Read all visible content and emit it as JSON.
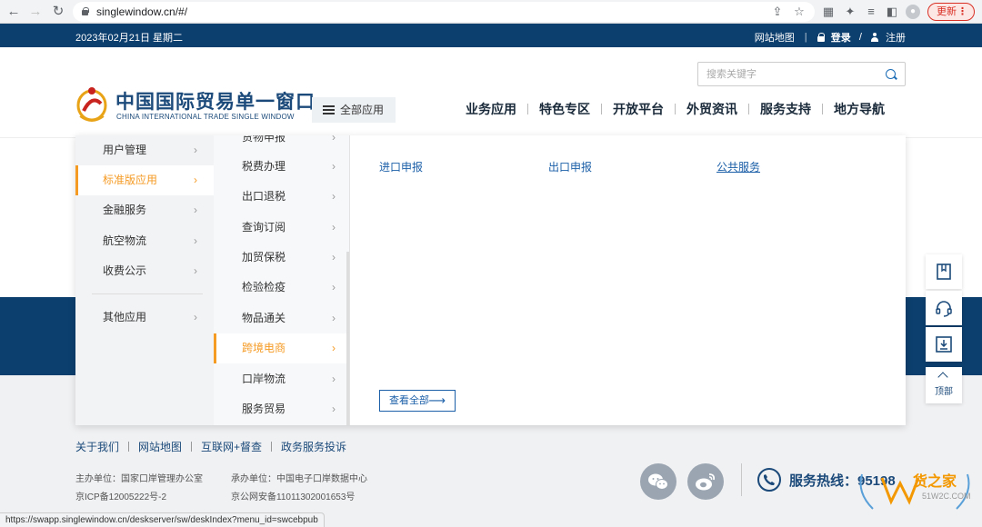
{
  "browser": {
    "url": "singlewindow.cn/#/",
    "update_label": "更新",
    "status_url": "https://swapp.singlewindow.cn/deskserver/sw/deskIndex?menu_id=swcebpub"
  },
  "topbar": {
    "date": "2023年02月21日 星期二",
    "sitemap": "网站地图",
    "login": "登录",
    "slash": "/",
    "register": "注册"
  },
  "header": {
    "logo_cn": "中国国际贸易单一窗口",
    "logo_en": "CHINA INTERNATIONAL TRADE SINGLE WINDOW",
    "all_apps": "全部应用",
    "search_placeholder": "搜索关键字",
    "nav": [
      "业务应用",
      "特色专区",
      "开放平台",
      "外贸资讯",
      "服务支持",
      "地方导航"
    ]
  },
  "menu": {
    "col1": [
      {
        "label": "用户管理",
        "arrow": "›"
      },
      {
        "label": "标准版应用",
        "arrow": "›"
      },
      {
        "label": "金融服务",
        "arrow": "›"
      },
      {
        "label": "航空物流",
        "arrow": "›"
      },
      {
        "label": "收费公示",
        "arrow": "›"
      },
      {
        "label": "其他应用",
        "arrow": "›"
      }
    ],
    "col2": [
      {
        "label": "货物申报",
        "arrow": "›"
      },
      {
        "label": "税费办理",
        "arrow": "›"
      },
      {
        "label": "出口退税",
        "arrow": "›"
      },
      {
        "label": "查询订阅",
        "arrow": "›"
      },
      {
        "label": "加贸保税",
        "arrow": "›"
      },
      {
        "label": "检验检疫",
        "arrow": "›"
      },
      {
        "label": "物品通关",
        "arrow": "›"
      },
      {
        "label": "跨境电商",
        "arrow": "›"
      },
      {
        "label": "口岸物流",
        "arrow": "›"
      },
      {
        "label": "服务贸易",
        "arrow": "›"
      }
    ],
    "col3": [
      "进口申报",
      "出口申报",
      "公共服务"
    ],
    "view_all": "查看全部",
    "view_all_arrow": "⟶"
  },
  "float": {
    "top_label": "顶部"
  },
  "footer": {
    "links": [
      "关于我们",
      "网站地图",
      "互联网+督查",
      "政务服务投诉"
    ],
    "host": "主办单位：国家口岸管理办公室",
    "icp": "京ICP备12005222号-2",
    "organizer": "承办单位：中国电子口岸数据中心",
    "security": "京公网安备11011302001653号",
    "hotline": "服务热线：95198",
    "watermark_text": "货之家",
    "watermark_sub": "51W2C.COM"
  }
}
